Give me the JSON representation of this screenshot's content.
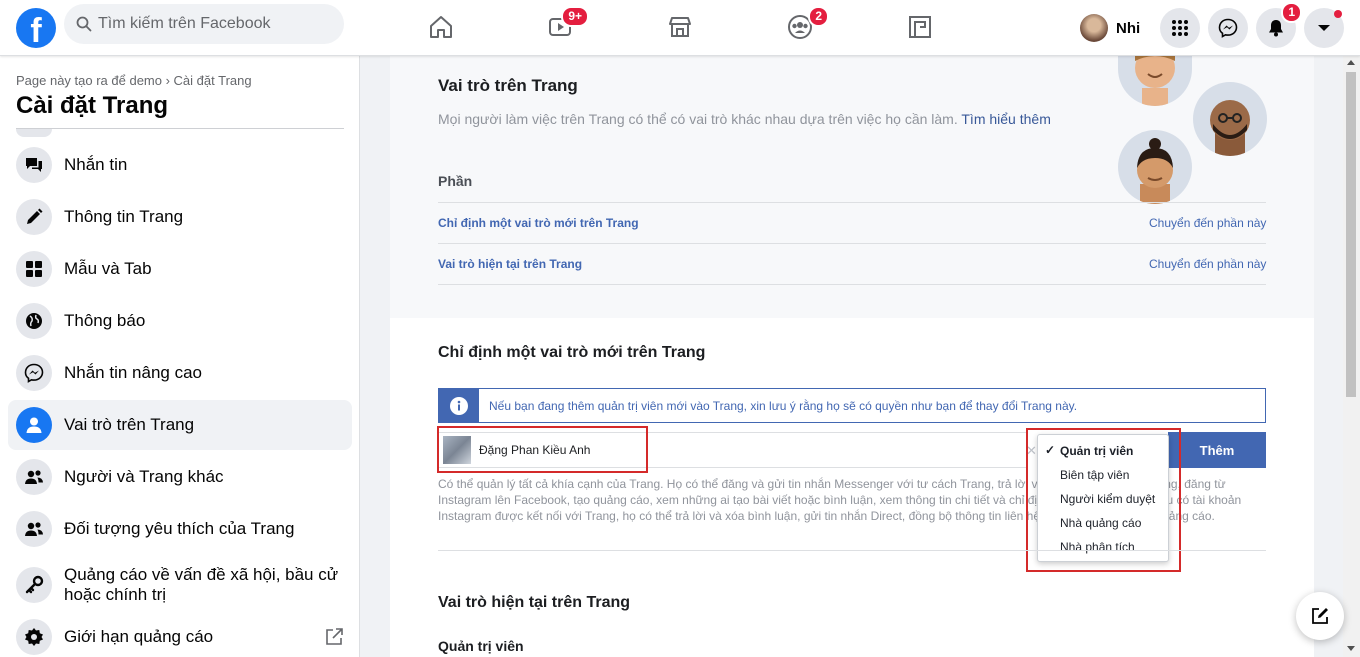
{
  "topbar": {
    "logo": "f",
    "search_placeholder": "Tìm kiếm trên Facebook",
    "watch_badge": "9+",
    "groups_badge": "2",
    "profile_name": "Nhi",
    "notif_badge": "1"
  },
  "sidebar": {
    "breadcrumb": "Page này tạo ra để demo › Cài đặt Trang",
    "title": "Cài đặt Trang",
    "items": [
      {
        "label": "Nhắn tin",
        "icon": "messages-icon"
      },
      {
        "label": "Thông tin Trang",
        "icon": "pencil-icon"
      },
      {
        "label": "Mẫu và Tab",
        "icon": "grid-icon"
      },
      {
        "label": "Thông báo",
        "icon": "globe-icon"
      },
      {
        "label": "Nhắn tin nâng cao",
        "icon": "messenger-icon"
      },
      {
        "label": "Vai trò trên Trang",
        "icon": "person-icon"
      },
      {
        "label": "Người và Trang khác",
        "icon": "people-icon"
      },
      {
        "label": "Đối tượng yêu thích của Trang",
        "icon": "people-icon"
      },
      {
        "label": "Quảng cáo về vấn đề xã hội, bầu cử hoặc chính trị",
        "icon": "key-icon"
      },
      {
        "label": "Giới hạn quảng cáo",
        "icon": "gear-icon"
      }
    ]
  },
  "roles": {
    "title": "Vai trò trên Trang",
    "subtitle": "Mọi người làm việc trên Trang có thể có vai trò khác nhau dựa trên việc họ cần làm.",
    "learn_more": "Tìm hiểu thêm",
    "section_header": "Phần",
    "rows": [
      {
        "label": "Chỉ định một vai trò mới trên Trang",
        "action": "Chuyển đến phần này"
      },
      {
        "label": "Vai trò hiện tại trên Trang",
        "action": "Chuyển đến phần này"
      }
    ]
  },
  "assign": {
    "title": "Chỉ định một vai trò mới trên Trang",
    "info": "Nếu bạn đang thêm quản trị viên mới vào Trang, xin lưu ý rằng họ sẽ có quyền như bạn để thay đổi Trang này.",
    "person_name": "Đặng Phan Kiều Anh",
    "add_button": "Thêm",
    "description": "Có thể quản lý tất cả khía cạnh của Trang. Họ có thể đăng và gửi tin nhắn Messenger với tư cách Trang, trả lời và xóa bình luận trên Trang, đăng từ Instagram lên Facebook, tạo quảng cáo, xem những ai tạo bài viết hoặc bình luận, xem thông tin chi tiết và chỉ định vai trò trên Trang. Nếu có tài khoản Instagram được kết nối với Trang, họ có thể trả lời và xóa bình luận, gửi tin nhắn Direct, đồng bộ thông tin liên hệ doanh nghiệp và tạo quảng cáo.",
    "dropdown": {
      "options": [
        "Quản trị viên",
        "Biên tập viên",
        "Người kiểm duyệt",
        "Nhà quảng cáo",
        "Nhà phân tích"
      ],
      "selected": "Quản trị viên"
    }
  },
  "current": {
    "title": "Vai trò hiện tại trên Trang",
    "first_role": "Quản trị viên"
  },
  "colors": {
    "brand": "#1877f2",
    "link": "#4267b2",
    "highlight_border": "#d42a2a"
  }
}
